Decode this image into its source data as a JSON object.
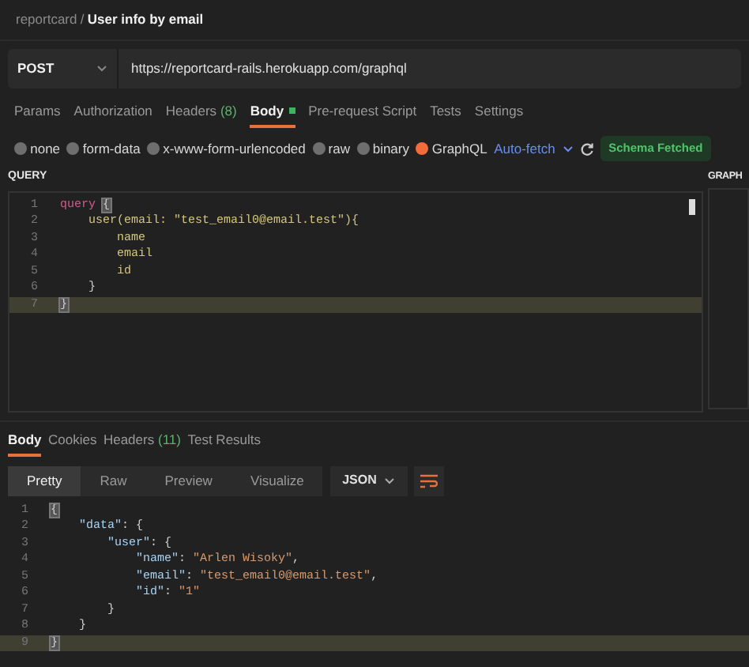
{
  "breadcrumb": {
    "collection": "reportcard",
    "separator": "/",
    "request": "User info by email"
  },
  "request": {
    "method": "POST",
    "url": "https://reportcard-rails.herokuapp.com/graphql"
  },
  "request_tabs": [
    {
      "label": "Params",
      "dot": false,
      "selected": false
    },
    {
      "label": "Authorization",
      "dot": false,
      "selected": false
    },
    {
      "label": "Headers",
      "count": "(8)",
      "dot": false,
      "selected": false
    },
    {
      "label": "Body",
      "dot": true,
      "selected": true
    },
    {
      "label": "Pre-request Script",
      "dot": false,
      "selected": false
    },
    {
      "label": "Tests",
      "dot": false,
      "selected": false
    },
    {
      "label": "Settings",
      "dot": false,
      "selected": false
    }
  ],
  "body_types": [
    {
      "label": "none",
      "selected": false
    },
    {
      "label": "form-data",
      "selected": false
    },
    {
      "label": "x-www-form-urlencoded",
      "selected": false
    },
    {
      "label": "raw",
      "selected": false
    },
    {
      "label": "binary",
      "selected": false
    },
    {
      "label": "GraphQL",
      "selected": true
    }
  ],
  "auto_fetch": "Auto-fetch",
  "schema_status": "Schema Fetched",
  "query_panel": {
    "title": "QUERY",
    "lines": [
      {
        "number": "1",
        "current": false,
        "tokens": [
          {
            "text": "query ",
            "kind": "keyword"
          },
          {
            "text": "{",
            "kind": "bracket"
          }
        ]
      },
      {
        "number": "2",
        "current": false,
        "tokens": [
          {
            "text": "    user(email: \"test_email0@email.test\"){",
            "kind": "field"
          }
        ]
      },
      {
        "number": "3",
        "current": false,
        "tokens": [
          {
            "text": "        name",
            "kind": "field"
          }
        ]
      },
      {
        "number": "4",
        "current": false,
        "tokens": [
          {
            "text": "        email",
            "kind": "field"
          }
        ]
      },
      {
        "number": "5",
        "current": false,
        "tokens": [
          {
            "text": "        id",
            "kind": "field"
          }
        ]
      },
      {
        "number": "6",
        "current": false,
        "tokens": [
          {
            "text": "    }",
            "kind": "punct"
          }
        ]
      },
      {
        "number": "7",
        "current": true,
        "tokens": [
          {
            "text": "}",
            "kind": "bracket"
          }
        ]
      }
    ]
  },
  "variables_panel": {
    "title": "GRAPH"
  },
  "response_tabs": [
    {
      "label": "Body",
      "selected": true
    },
    {
      "label": "Cookies",
      "selected": false
    },
    {
      "label": "Headers",
      "count": "(11)",
      "selected": false
    },
    {
      "label": "Test Results",
      "selected": false
    }
  ],
  "view_modes": [
    {
      "label": "Pretty",
      "selected": true
    },
    {
      "label": "Raw",
      "selected": false
    },
    {
      "label": "Preview",
      "selected": false
    },
    {
      "label": "Visualize",
      "selected": false
    }
  ],
  "format": "JSON",
  "response_lines": [
    {
      "number": "1",
      "current": false,
      "tokens": [
        {
          "text": "{",
          "kind": "bracket"
        }
      ]
    },
    {
      "number": "2",
      "current": false,
      "tokens": [
        {
          "text": "    \"data\"",
          "kind": "key"
        },
        {
          "text": ": {",
          "kind": "punct"
        }
      ]
    },
    {
      "number": "3",
      "current": false,
      "tokens": [
        {
          "text": "        \"user\"",
          "kind": "key"
        },
        {
          "text": ": {",
          "kind": "punct"
        }
      ]
    },
    {
      "number": "4",
      "current": false,
      "tokens": [
        {
          "text": "            \"name\"",
          "kind": "key"
        },
        {
          "text": ": ",
          "kind": "punct"
        },
        {
          "text": "\"Arlen Wisoky\"",
          "kind": "string"
        },
        {
          "text": ",",
          "kind": "punct"
        }
      ]
    },
    {
      "number": "5",
      "current": false,
      "tokens": [
        {
          "text": "            \"email\"",
          "kind": "key"
        },
        {
          "text": ": ",
          "kind": "punct"
        },
        {
          "text": "\"test_email0@email.test\"",
          "kind": "string"
        },
        {
          "text": ",",
          "kind": "punct"
        }
      ]
    },
    {
      "number": "6",
      "current": false,
      "tokens": [
        {
          "text": "            \"id\"",
          "kind": "key"
        },
        {
          "text": ": ",
          "kind": "punct"
        },
        {
          "text": "\"1\"",
          "kind": "string"
        }
      ]
    },
    {
      "number": "7",
      "current": false,
      "tokens": [
        {
          "text": "        }",
          "kind": "punct"
        }
      ]
    },
    {
      "number": "8",
      "current": false,
      "tokens": [
        {
          "text": "    }",
          "kind": "punct"
        }
      ]
    },
    {
      "number": "9",
      "current": true,
      "tokens": [
        {
          "text": "}",
          "kind": "bracket"
        }
      ]
    }
  ]
}
